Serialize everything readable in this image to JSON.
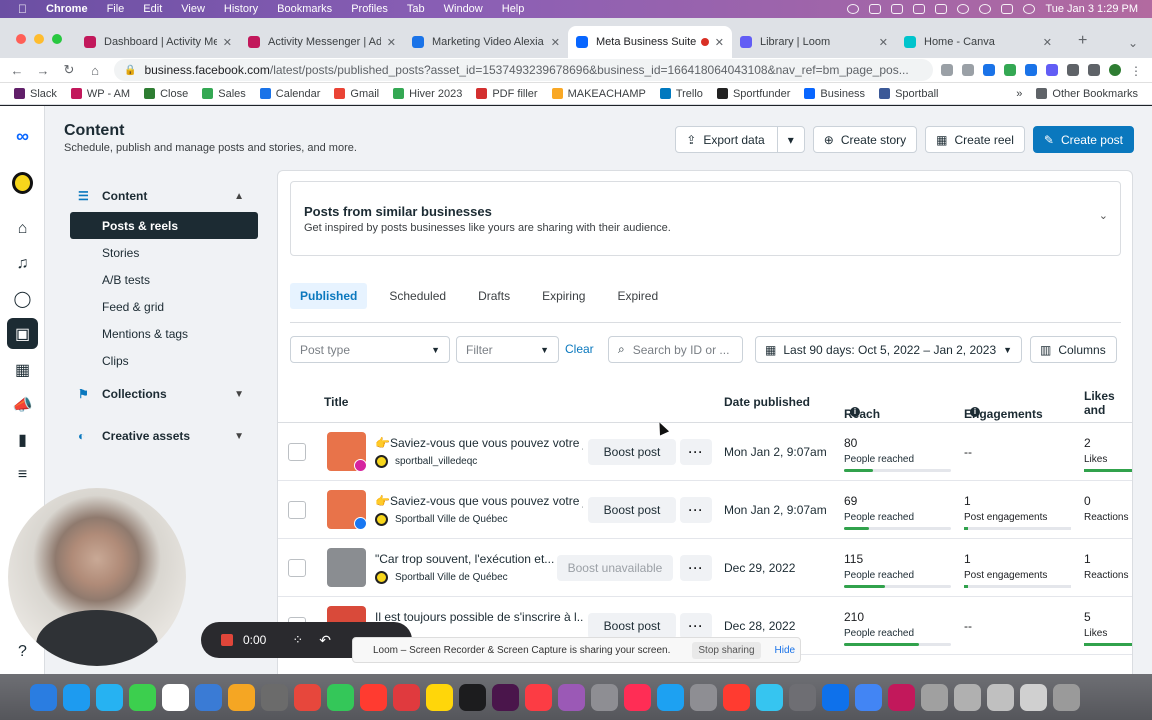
{
  "menubar": {
    "app": "Chrome",
    "items": [
      "File",
      "Edit",
      "View",
      "History",
      "Bookmarks",
      "Profiles",
      "Tab",
      "Window",
      "Help"
    ],
    "clock": "Tue Jan 3  1:29 PM"
  },
  "tabs": [
    {
      "label": "Dashboard | Activity Me",
      "color": "#c2185b"
    },
    {
      "label": "Activity Messenger | Adm",
      "color": "#c2185b"
    },
    {
      "label": "Marketing Video Alexia -",
      "color": "#1a73e8"
    },
    {
      "label": "Meta Business Suite",
      "color": "#0866ff",
      "active": true
    },
    {
      "label": "Library | Loom",
      "color": "#625df5"
    },
    {
      "label": "Home - Canva",
      "color": "#00c4cc"
    }
  ],
  "address": {
    "host": "business.facebook.com",
    "path": "/latest/posts/published_posts?asset_id=1537493239678696&business_id=166418064043108&nav_ref=bm_page_pos..."
  },
  "bookmarks": [
    {
      "label": "Slack",
      "color": "#611f69"
    },
    {
      "label": "WP - AM",
      "color": "#c2185b"
    },
    {
      "label": "Close",
      "color": "#2e7d32"
    },
    {
      "label": "Sales",
      "color": "#34a853"
    },
    {
      "label": "Calendar",
      "color": "#1a73e8"
    },
    {
      "label": "Gmail",
      "color": "#ea4335"
    },
    {
      "label": "Hiver 2023",
      "color": "#34a853"
    },
    {
      "label": "PDF filler",
      "color": "#d32f2f"
    },
    {
      "label": "MAKEACHAMP",
      "color": "#f9a825"
    },
    {
      "label": "Trello",
      "color": "#0079bf"
    },
    {
      "label": "Sportfunder",
      "color": "#222222"
    },
    {
      "label": "Business",
      "color": "#0866ff"
    },
    {
      "label": "Sportball",
      "color": "#3b5998"
    }
  ],
  "bookmarks_other": "Other Bookmarks",
  "page": {
    "title": "Content",
    "subtitle": "Schedule, publish and manage posts and stories, and more.",
    "export_label": "Export data",
    "create_story": "Create story",
    "create_reel": "Create reel",
    "create_post": "Create post"
  },
  "sidebar": {
    "content_label": "Content",
    "items": [
      "Posts & reels",
      "Stories",
      "A/B tests",
      "Feed & grid",
      "Mentions & tags",
      "Clips"
    ],
    "collections": "Collections",
    "creative_assets": "Creative assets"
  },
  "similar": {
    "title": "Posts from similar businesses",
    "subtitle": "Get inspired by posts businesses like yours are sharing with their audience."
  },
  "post_tabs": [
    "Published",
    "Scheduled",
    "Drafts",
    "Expiring",
    "Expired"
  ],
  "filters": {
    "post_type": "Post type",
    "filter": "Filter",
    "clear": "Clear",
    "search_placeholder": "Search by ID or ...",
    "date_range": "Last 90 days: Oct 5, 2022 – Jan 2, 2023",
    "columns": "Columns"
  },
  "table": {
    "headers": {
      "title": "Title",
      "date": "Date published",
      "reach": "Reach",
      "engagements": "Engagements",
      "likes": "Likes and reactions"
    },
    "rows": [
      {
        "title": "👉Saviez-vous que vous pouvez votre j...",
        "account": "sportball_villedeqc",
        "platform": "instagram",
        "boost": "Boost post",
        "date": "Mon Jan 2, 9:07am",
        "reach": "80",
        "reach_label": "People reached",
        "reach_fill": 0.27,
        "eng": "--",
        "eng_label": "",
        "likes": "2",
        "likes_label": "Likes"
      },
      {
        "title": "👉Saviez-vous que vous pouvez votre j...",
        "account": "Sportball Ville de Québec",
        "platform": "facebook",
        "boost": "Boost post",
        "date": "Mon Jan 2, 9:07am",
        "reach": "69",
        "reach_label": "People reached",
        "reach_fill": 0.23,
        "eng": "1",
        "eng_label": "Post engagements",
        "likes": "0",
        "likes_label": "Reactions"
      },
      {
        "title": "\"Car trop souvent, l'exécution et...",
        "account": "Sportball Ville de Québec",
        "platform": "link",
        "boost": "Boost unavailable",
        "date": "Dec 29, 2022",
        "reach": "115",
        "reach_label": "People reached",
        "reach_fill": 0.38,
        "eng": "1",
        "eng_label": "Post engagements",
        "likes": "1",
        "likes_label": "Reactions"
      },
      {
        "title": "Il est toujours possible de s'inscrire à l...",
        "account": "",
        "platform": "facebook",
        "boost": "Boost post",
        "date": "Dec 28, 2022",
        "reach": "210",
        "reach_label": "People reached",
        "reach_fill": 0.7,
        "eng": "--",
        "eng_label": "",
        "likes": "5",
        "likes_label": "Likes"
      }
    ]
  },
  "recorder": {
    "time": "0:00",
    "share_text": "Loom – Screen Recorder & Screen Capture is sharing your screen.",
    "stop": "Stop sharing",
    "hide": "Hide"
  },
  "dock_colors": [
    "#2a7de1",
    "#1d9bf0",
    "#26b2f2",
    "#3ccf4e",
    "#ffffff",
    "#3a7bd5",
    "#f5a623",
    "#6b6b6b",
    "#e7473c",
    "#34c759",
    "#ff3b30",
    "#e03a3e",
    "#ffd60a",
    "#1c1c1e",
    "#4a154b",
    "#fc3c44",
    "#9b59b6",
    "#8e8e93",
    "#ff2d55",
    "#1da1f2",
    "#8e8e93",
    "#ff3b30",
    "#36c5f0",
    "#6e6e73",
    "#0e71eb",
    "#4285f4",
    "#c2185b",
    "#a0a0a0",
    "#b0b0b0",
    "#c0c0c0",
    "#d0d0d0",
    "#9a9a9a"
  ]
}
